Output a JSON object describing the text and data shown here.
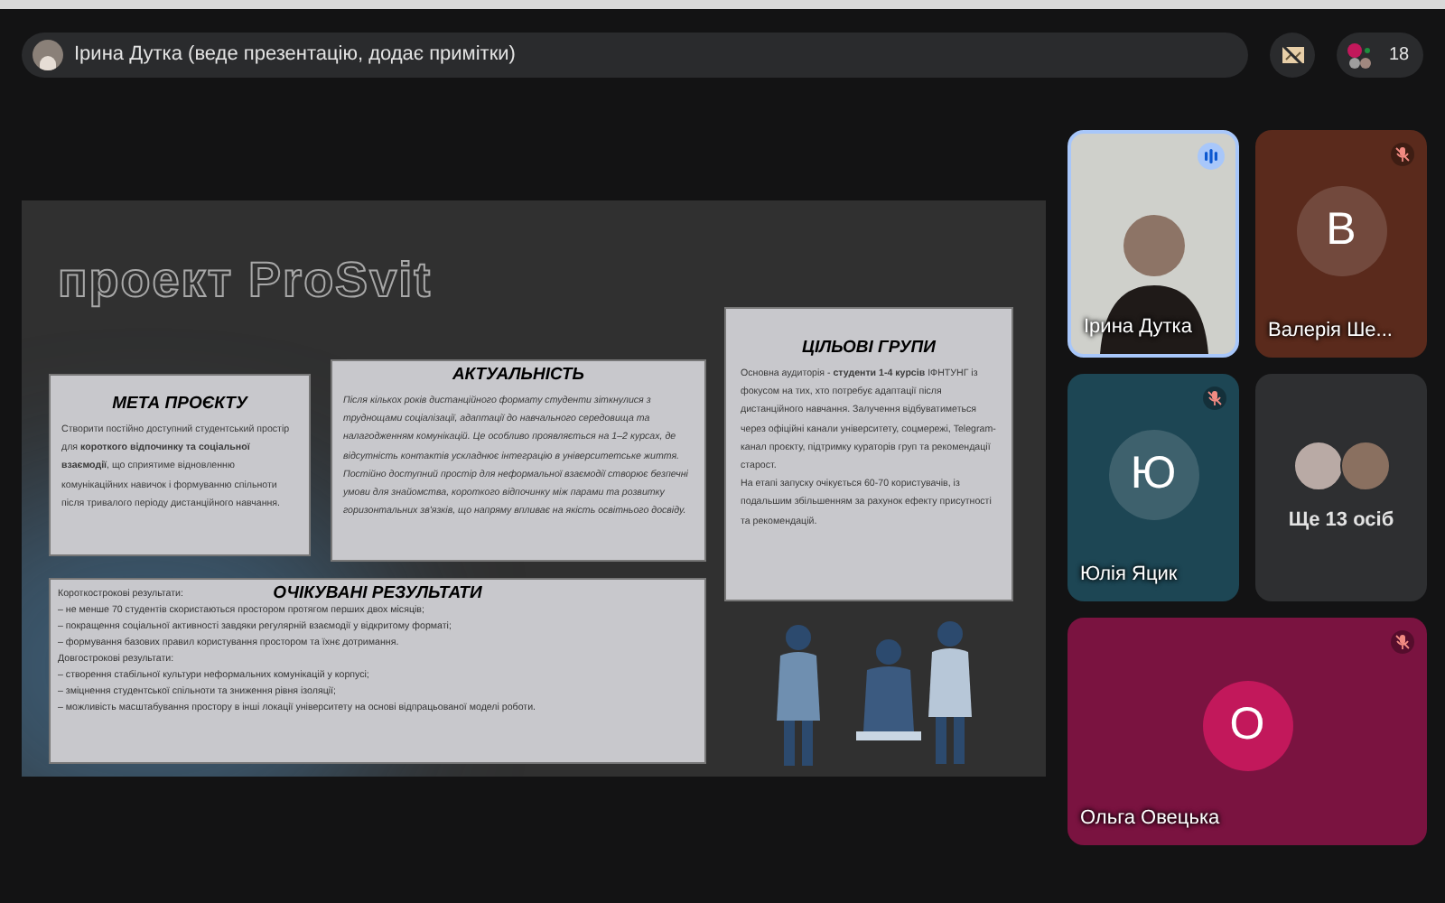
{
  "presenter_bar": {
    "label": "Ірина Дутка (веде презентацію, додає примітки)"
  },
  "participants_button": {
    "count": "18"
  },
  "slide": {
    "title": "проект ProSvit",
    "cards": [
      {
        "kind": "paragraph",
        "heading": "МЕТА ПРОЄКТУ",
        "italic": false,
        "paragraphs": [
          "Створити постійно доступний студентський простір для **короткого відпочинку та соціальної взаємодії**, що сприятиме відновленню комунікаційних навичок і формуванню спільноти після тривалого періоду дистанційного навчання."
        ]
      },
      {
        "kind": "paragraph",
        "heading": "АКТУАЛЬНІСТЬ",
        "italic": true,
        "paragraphs": [
          "Після кількох років дистанційного формату студенти зіткнулися з труднощами соціалізації, адаптації до навчального середовища та налагодженням комунікацій. Це особливо проявляється на 1–2 курсах, де відсутність контактів ускладнює інтеграцію в університетське життя. Постійно доступний простір для неформальної взаємодії створює безпечні умови для знайомства, короткого відпочинку між парами та розвитку горизонтальних зв'язків, що напряму впливає на якість освітнього досвіду."
        ]
      },
      {
        "kind": "paragraph",
        "heading": "ЦІЛЬОВІ ГРУПИ",
        "italic": false,
        "paragraphs": [
          "Основна аудиторія - **студенти 1-4 курсів** ІФНТУНГ із фокусом на тих, хто потребує адаптації після дистанційного навчання. Залучення відбуватиметься через офіційні канали університету, соцмережі, Telegram-канал проєкту, підтримку кураторів груп та рекомендації старост.",
          "На етапі запуску очікується 60-70 користувачів, із подальшим збільшенням за рахунок ефекту присутності та рекомендацій."
        ]
      },
      {
        "kind": "list",
        "heading": "ОЧІКУВАНІ РЕЗУЛЬТАТИ",
        "italic": false,
        "paragraphs": [
          "Короткострокові результати:",
          "– не менше 70 студентів скористаються простором протягом перших двох місяців;",
          "– покращення соціальної активності завдяки регулярній взаємодії у відкритому форматі;",
          "– формування базових правил користування простором та їхнє дотримання.",
          "Довгострокові результати:",
          "– створення стабільної культури неформальних комунікацій у корпусі;",
          "– зміцнення студентської спільноти та зниження рівня ізоляції;",
          "– можливість масштабування простору в інші локації університету на основі відпрацьованої моделі роботи."
        ]
      }
    ]
  },
  "participants": [
    {
      "kind": "video",
      "name": "Ірина Дутка",
      "muted": false,
      "speaking": true
    },
    {
      "kind": "avatar",
      "name": "Валерія Ше...",
      "initial": "В",
      "muted": true,
      "speaking": false,
      "color": "#5a2a1c"
    },
    {
      "kind": "avatar",
      "name": "Юлія Яцик",
      "initial": "Ю",
      "muted": true,
      "speaking": false,
      "color": "#1d4654"
    },
    {
      "kind": "others",
      "label": "Ще 13 осіб"
    },
    {
      "kind": "avatar",
      "name": "Ольга Овецька",
      "initial": "О",
      "muted": true,
      "speaking": false,
      "color": "#7a1340"
    }
  ]
}
